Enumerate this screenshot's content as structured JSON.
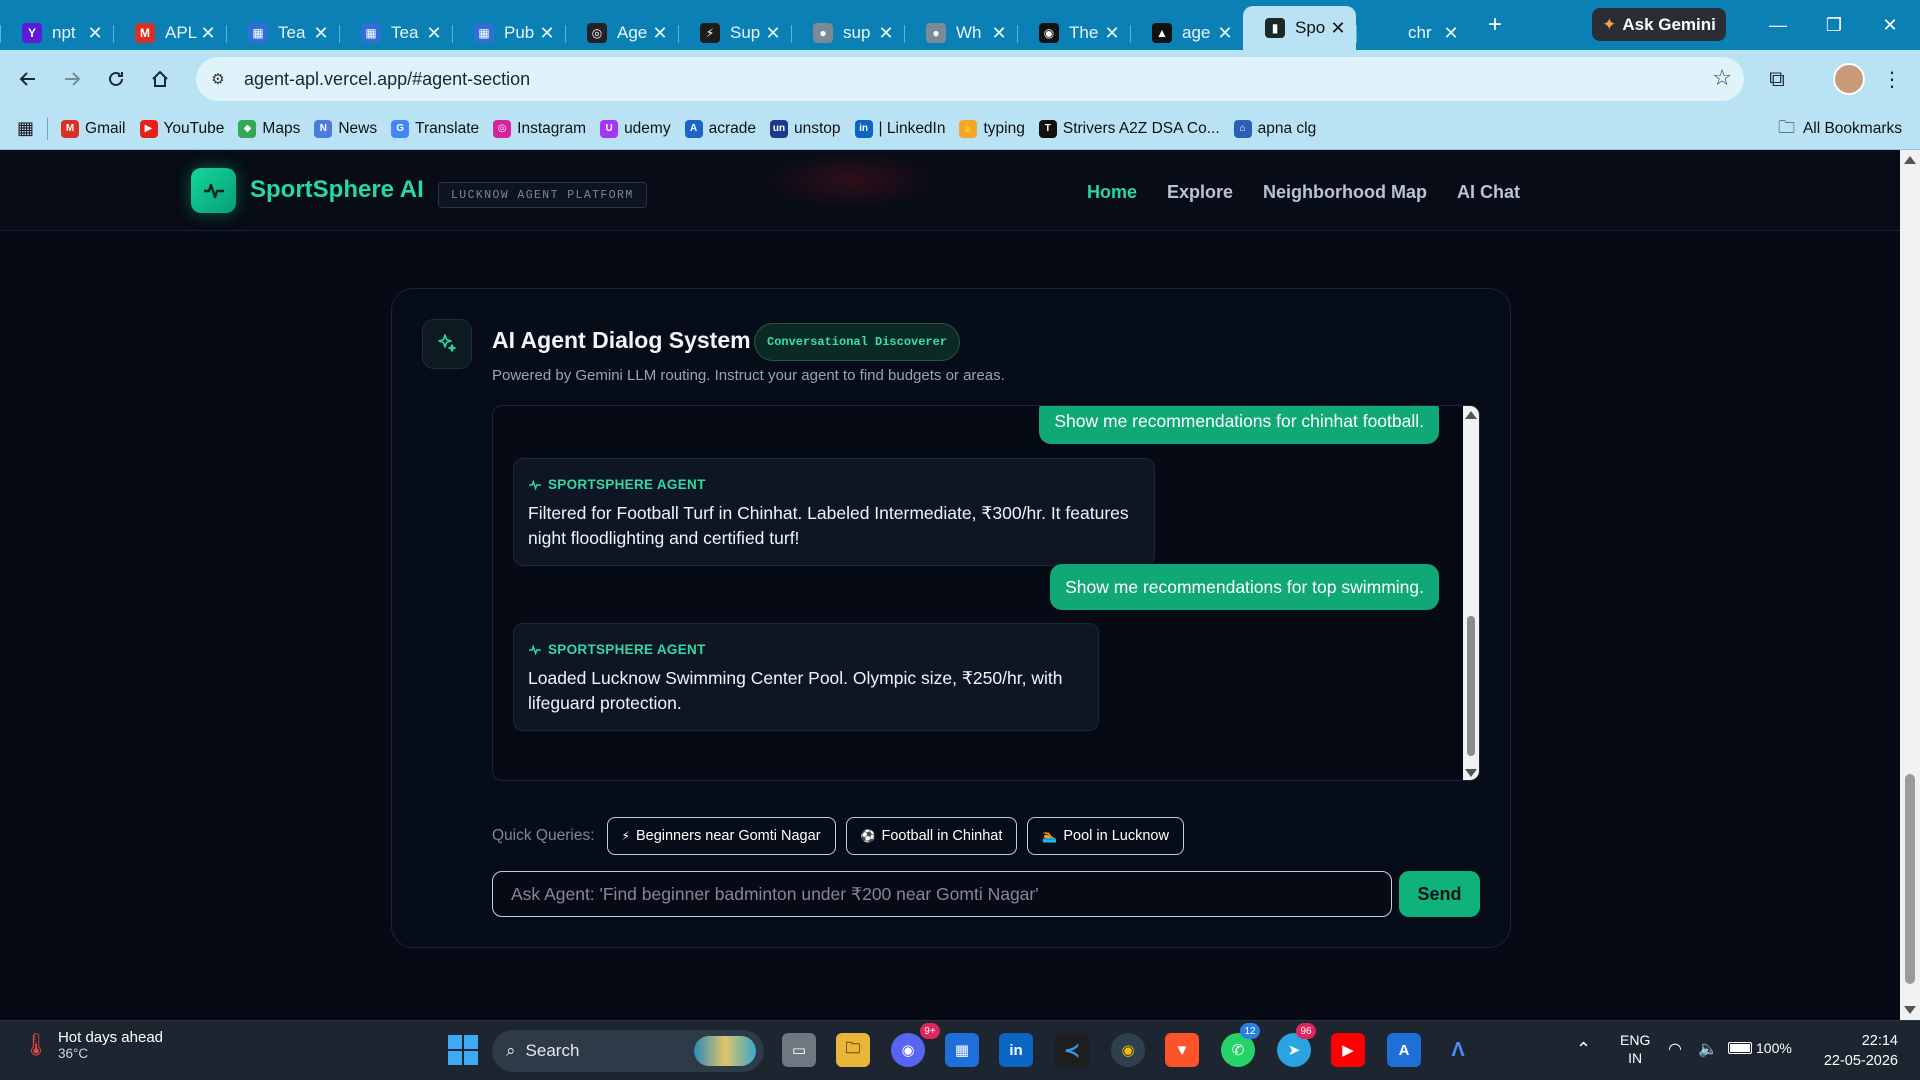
{
  "browser": {
    "tabs": [
      {
        "title": "npt",
        "fav": "Y",
        "color": "#5c1bd6"
      },
      {
        "title": "APL",
        "fav": "M",
        "color": "#d93025"
      },
      {
        "title": "Tea",
        "fav": "▦",
        "color": "#2f6fd6"
      },
      {
        "title": "Tea",
        "fav": "▦",
        "color": "#2f6fd6"
      },
      {
        "title": "Pub",
        "fav": "▦",
        "color": "#2f6fd6"
      },
      {
        "title": "Age",
        "fav": "◎",
        "color": "#222"
      },
      {
        "title": "Sup",
        "fav": "⚡",
        "color": "#1c1c1c"
      },
      {
        "title": "sup",
        "fav": "●",
        "color": "#7a8a96"
      },
      {
        "title": "Wh",
        "fav": "●",
        "color": "#7a8a96"
      },
      {
        "title": "The",
        "fav": "◉",
        "color": "#111"
      },
      {
        "title": "age",
        "fav": "▲",
        "color": "#111"
      },
      {
        "title": "Spo",
        "fav": "▮",
        "color": "#1a2a28"
      },
      {
        "title": "chr",
        "fav": "",
        "color": "transparent"
      }
    ],
    "active_tab": 11,
    "ask_gemini": "Ask Gemini",
    "url": "agent-apl.vercel.app/#agent-section",
    "bookmarks": [
      {
        "label": "Gmail",
        "icon": "M",
        "color": "#d93025"
      },
      {
        "label": "YouTube",
        "icon": "▶",
        "color": "#e62117"
      },
      {
        "label": "Maps",
        "icon": "◆",
        "color": "#34a853"
      },
      {
        "label": "News",
        "icon": "N",
        "color": "#4c7bd9"
      },
      {
        "label": "Translate",
        "icon": "G",
        "color": "#4285f4"
      },
      {
        "label": "Instagram",
        "icon": "◎",
        "color": "#d6249f"
      },
      {
        "label": "udemy",
        "icon": "U",
        "color": "#a435f0"
      },
      {
        "label": "acrade",
        "icon": "A",
        "color": "#1e63c6"
      },
      {
        "label": "unstop",
        "icon": "un",
        "color": "#1c3a8a"
      },
      {
        "label": "| LinkedIn",
        "icon": "in",
        "color": "#0a66c2"
      },
      {
        "label": "typing",
        "icon": "✋",
        "color": "#f4a52a"
      },
      {
        "label": "Strivers A2Z DSA Co...",
        "icon": "T",
        "color": "#111"
      },
      {
        "label": "apna clg",
        "icon": "⌂",
        "color": "#2b5fb4"
      }
    ],
    "all_bookmarks": "All Bookmarks"
  },
  "site": {
    "brand": "SportSphere AI",
    "platform_tag": "LUCKNOW AGENT PLATFORM",
    "nav": [
      "Home",
      "Explore",
      "Neighborhood Map",
      "AI Chat"
    ],
    "active_nav": 0
  },
  "agent": {
    "title": "AI Agent Dialog System",
    "badge": "Conversational Discoverer",
    "subtitle": "Powered by Gemini LLM routing. Instruct your agent to find budgets or areas.",
    "agent_label": "SPORTSPHERE AGENT",
    "messages": [
      {
        "role": "user",
        "text": "Show me recommendations for chinhat football."
      },
      {
        "role": "agent",
        "text": "Filtered for Football Turf in Chinhat. Labeled Intermediate, ₹300/hr. It features night floodlighting and certified turf!"
      },
      {
        "role": "user",
        "text": "Show me recommendations for top swimming."
      },
      {
        "role": "agent",
        "text": "Loaded Lucknow Swimming Center Pool. Olympic size, ₹250/hr, with lifeguard protection."
      }
    ],
    "quick_label": "Quick Queries:",
    "quick_queries": [
      {
        "icon": "⚡",
        "label": "Beginners near Gomti Nagar"
      },
      {
        "icon": "⚽",
        "label": "Football in Chinhat"
      },
      {
        "icon": "🏊",
        "label": "Pool in Lucknow"
      }
    ],
    "input_placeholder": "Ask Agent: 'Find beginner badminton under ₹200 near Gomti Nagar'",
    "input_value": "",
    "send_label": "Send"
  },
  "taskbar": {
    "weather_title": "Hot days ahead",
    "weather_temp": "36°C",
    "search_label": "Search",
    "lang1": "ENG",
    "lang2": "IN",
    "battery": "100%",
    "time": "22:14",
    "date": "22-05-2026",
    "badges": {
      "discord": "9+",
      "telegram": "96",
      "whatsapp": "12"
    }
  }
}
